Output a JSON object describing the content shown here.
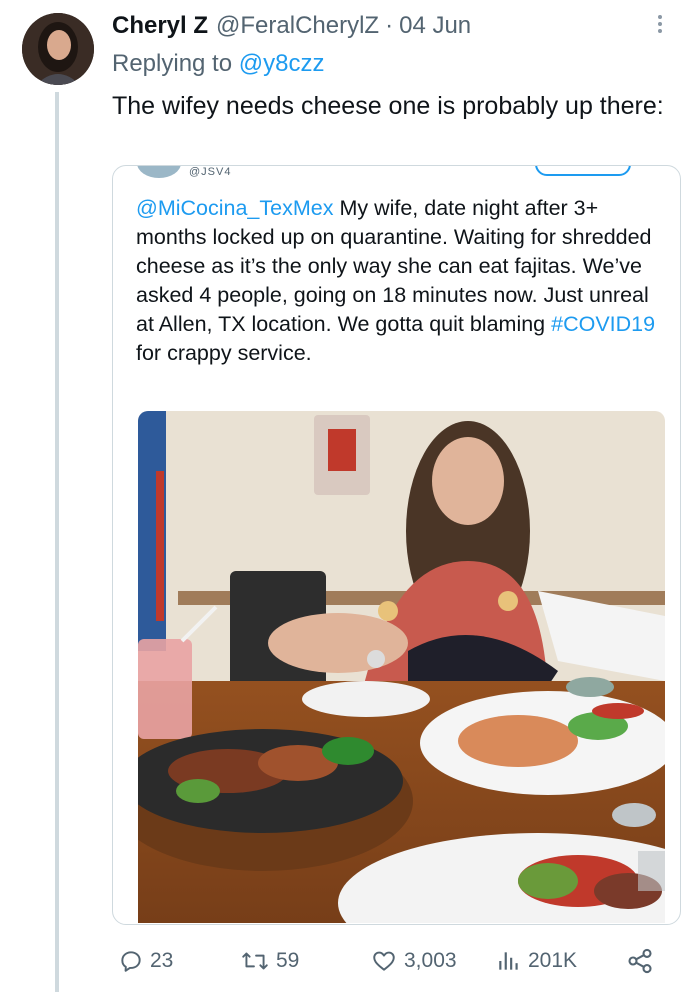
{
  "tweet": {
    "display_name": "Cheryl Z",
    "handle": "@FeralCherylZ",
    "separator": "·",
    "date": "04 Jun",
    "replying_prefix": "Replying to",
    "replying_to": "@y8czz",
    "text": "The wifey needs cheese one is probably up there:"
  },
  "quoted": {
    "mention": "@MiCocina_TexMex",
    "text_part1": " My wife, date night after 3+ months locked up on quarantine. Waiting for shredded cheese as it’s the only way she can eat fajitas. We’ve asked 4 people, going on 18 minutes now. Just unreal at Allen, TX location. We gotta quit blaming ",
    "hashtag": "#COVID19",
    "text_part2": " for crappy service.",
    "partial_handle": "@JSV4"
  },
  "actions": {
    "replies": "23",
    "retweets": "59",
    "likes": "3,003",
    "views": "201K"
  },
  "icons": [
    "more-icon",
    "reply-icon",
    "retweet-icon",
    "like-icon",
    "views-icon",
    "share-icon"
  ],
  "colors": {
    "accent": "#1d9bf0",
    "secondary_text": "#536471",
    "border": "#cfd9de"
  }
}
